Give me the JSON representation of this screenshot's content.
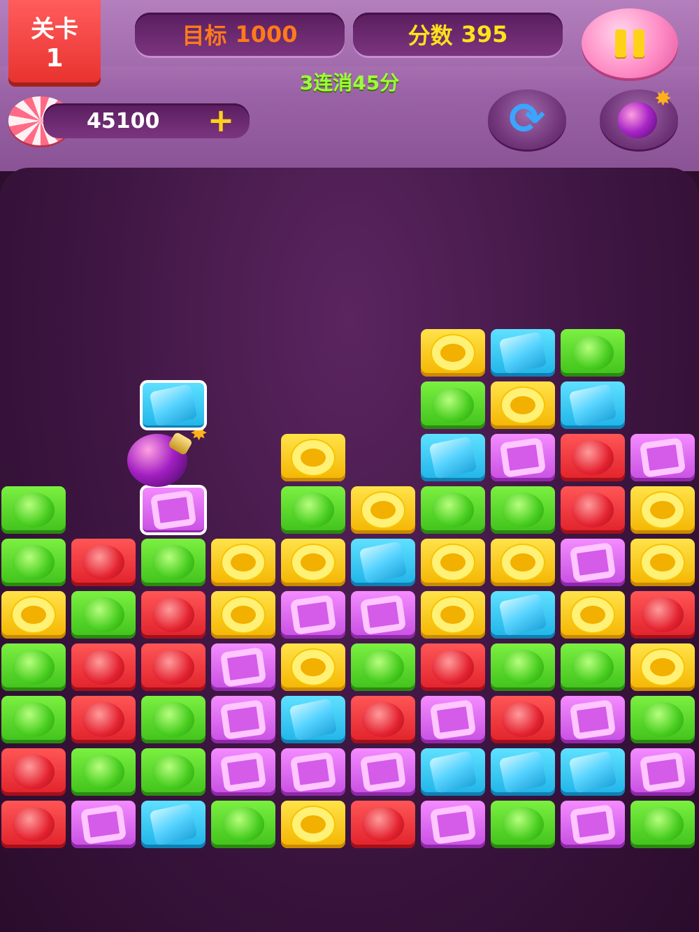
{
  "header": {
    "level_label": "关卡",
    "level_number": "1",
    "goal_label": "目标",
    "goal_value": "1000",
    "score_label": "分数",
    "score_value": "395",
    "combo_text": "3连消45分",
    "coins": "45100",
    "plus_symbol": "+"
  },
  "buttons": {
    "pause": "pause-icon",
    "refresh": "refresh-icon",
    "bomb": "bomb-icon",
    "refresh_glyph": "⟳"
  },
  "board": {
    "columns": 10,
    "column_heights": [
      7,
      6,
      9,
      6,
      8,
      7,
      10,
      10,
      10,
      9
    ],
    "rows_bottom_to_top": [
      [
        "red",
        "purple",
        "blue",
        "green",
        "yellow",
        "red",
        "purple",
        "green",
        "purple",
        "green"
      ],
      [
        "red",
        "green",
        "green",
        "purple",
        "purple",
        "purple",
        "blue",
        "blue",
        "blue",
        "purple"
      ],
      [
        "green",
        "red",
        "green",
        "purple",
        "blue",
        "red",
        "purple",
        "red",
        "purple",
        "green"
      ],
      [
        "green",
        "red",
        "red",
        "purple",
        "yellow",
        "green",
        "red",
        "green",
        "green",
        "yellow"
      ],
      [
        "yellow",
        "green",
        "red",
        "yellow",
        "purple",
        "purple",
        "yellow",
        "blue",
        "yellow",
        "red"
      ],
      [
        "green",
        "red",
        "green",
        "yellow",
        "yellow",
        "blue",
        "yellow",
        "yellow",
        "purple",
        "yellow"
      ],
      [
        "green",
        null,
        "purple",
        null,
        "green",
        "yellow",
        "green",
        "green",
        "red",
        "yellow"
      ],
      [
        null,
        null,
        "bomb",
        null,
        "yellow",
        null,
        "blue",
        "purple",
        "red",
        "purple"
      ],
      [
        null,
        null,
        "blue",
        null,
        null,
        null,
        "green",
        "yellow",
        "blue",
        null
      ],
      [
        null,
        null,
        null,
        null,
        null,
        null,
        "yellow",
        "blue",
        "green",
        null
      ]
    ],
    "selected_column": 2
  }
}
